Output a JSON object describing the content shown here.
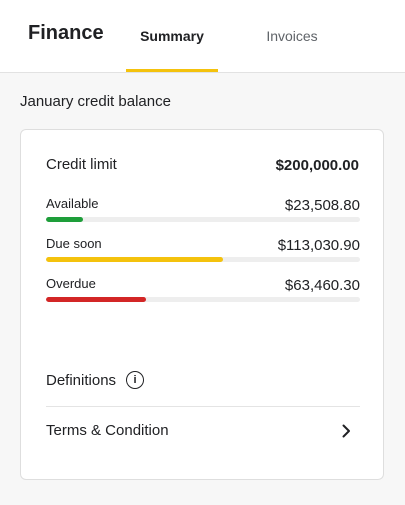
{
  "header": {
    "title": "Finance",
    "tabs": [
      {
        "label": "Summary",
        "active": true
      },
      {
        "label": "Invoices",
        "active": false
      }
    ],
    "accent_color": "#f4c20d"
  },
  "section_title": "January credit balance",
  "credit": {
    "limit_label": "Credit limit",
    "limit_value": "$200,000.00",
    "rows": [
      {
        "label": "Available",
        "value": "$23,508.80",
        "fraction": 0.118,
        "color": "#1e9e3a"
      },
      {
        "label": "Due soon",
        "value": "$113,030.90",
        "fraction": 0.565,
        "color": "#f4c20d"
      },
      {
        "label": "Overdue",
        "value": "$63,460.30",
        "fraction": 0.317,
        "color": "#d32626"
      }
    ]
  },
  "definitions": {
    "label": "Definitions",
    "icon": "info-icon"
  },
  "terms": {
    "label": "Terms & Condition",
    "icon": "chevron-right-icon"
  }
}
